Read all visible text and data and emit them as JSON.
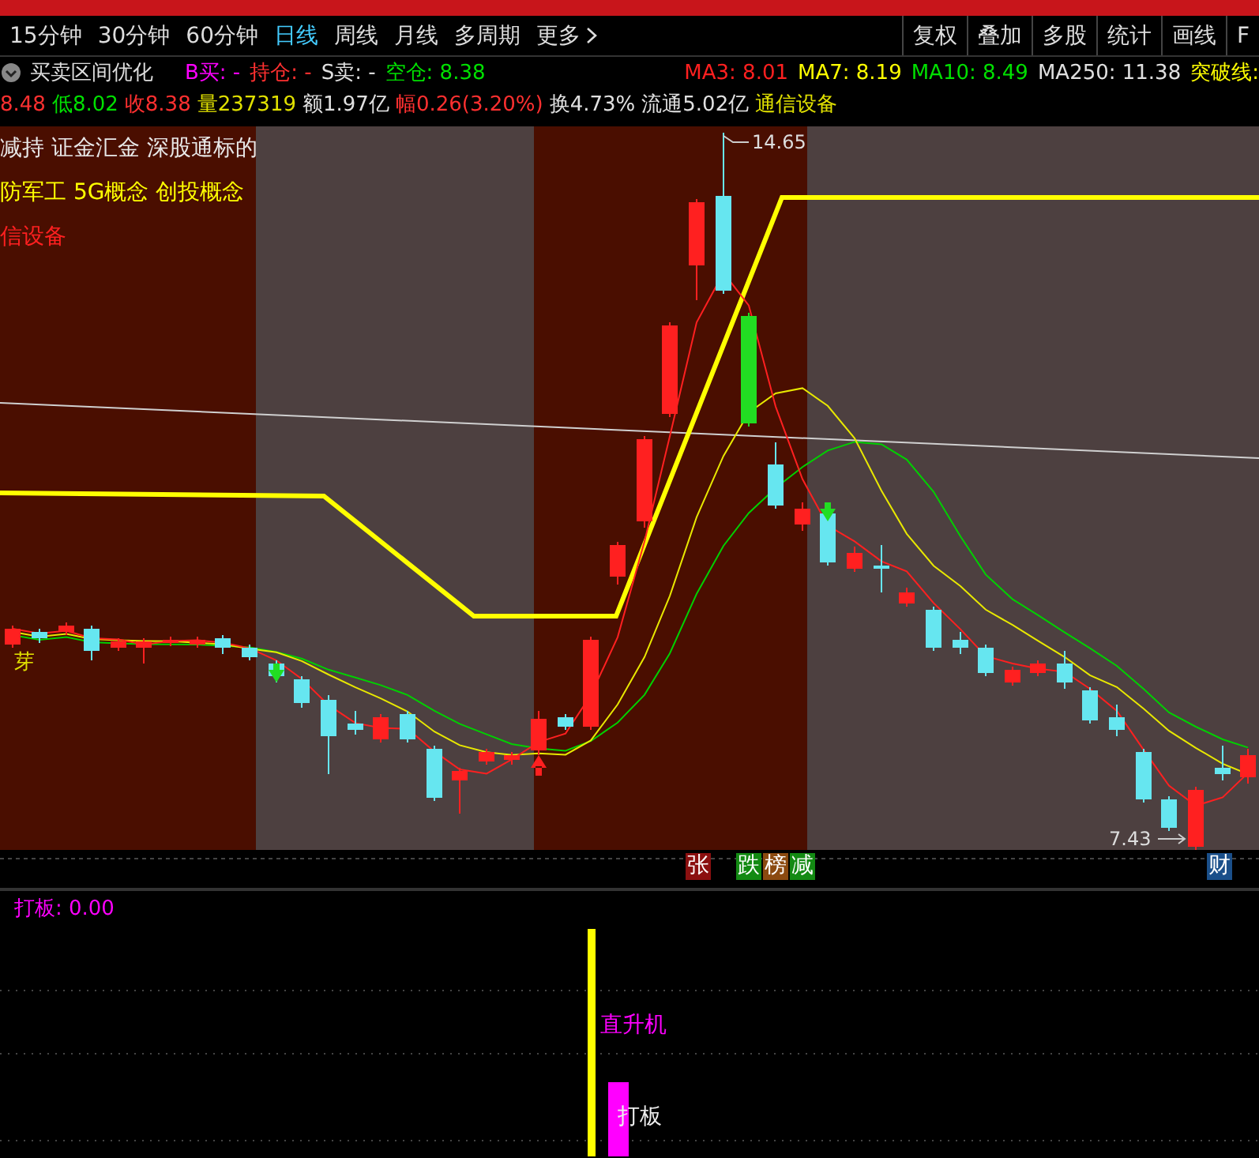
{
  "toolbar": {
    "periods": [
      {
        "label": "15分钟",
        "selected": false
      },
      {
        "label": "30分钟",
        "selected": false
      },
      {
        "label": "60分钟",
        "selected": false
      },
      {
        "label": "日线",
        "selected": true
      },
      {
        "label": "周线",
        "selected": false
      },
      {
        "label": "月线",
        "selected": false
      },
      {
        "label": "多周期",
        "selected": false
      }
    ],
    "more": "更多",
    "tools": [
      "复权",
      "叠加",
      "多股",
      "统计",
      "画线",
      "F"
    ]
  },
  "indicator": {
    "name": "买卖区间优化",
    "values": [
      {
        "text": "B买: -",
        "color": "#ff00ff"
      },
      {
        "text": "持仓: -",
        "color": "#ff3030"
      },
      {
        "text": "S卖: -",
        "color": "#e0e0e0"
      },
      {
        "text": "空仓: 8.38",
        "color": "#00e000"
      }
    ],
    "averages": [
      {
        "text": "MA3: 8.01",
        "color": "#ff2020"
      },
      {
        "text": "MA7: 8.19",
        "color": "#ffff00"
      },
      {
        "text": "MA10: 8.49",
        "color": "#00e000"
      },
      {
        "text": "MA250: 11.38",
        "color": "#e0e0e0"
      },
      {
        "text": "突破线:",
        "color": "#ffff00"
      }
    ]
  },
  "quote": [
    {
      "text": "8.48",
      "color": "#ff3030"
    },
    {
      "text": "低8.02",
      "color": "#00e000"
    },
    {
      "text": "收8.38",
      "color": "#ff3030"
    },
    {
      "text": "量237319",
      "color": "#e0e000"
    },
    {
      "text": "额1.97亿",
      "color": "#e0e0e0"
    },
    {
      "text": "幅0.26(3.20%)",
      "color": "#ff3030"
    },
    {
      "text": "换4.73%",
      "color": "#e0e0e0"
    },
    {
      "text": "流通5.02亿",
      "color": "#e0e0e0"
    },
    {
      "text": "通信设备",
      "color": "#e0e000"
    }
  ],
  "chart": {
    "concepts": [
      {
        "text": "减持 证金汇金 深股通标的",
        "color": "#e8e8e8"
      },
      {
        "text": "防军工 5G概念 创投概念",
        "color": "#ffff00"
      },
      {
        "text": "信设备",
        "color": "#ff2020"
      }
    ],
    "high_label": "14.65",
    "low_label": "7.43",
    "signal": "芽"
  },
  "markers": [
    {
      "text": "张",
      "color": "#8b1010"
    },
    {
      "text": "跌",
      "color": "#138a13"
    },
    {
      "text": "榜",
      "color": "#8b4a10"
    },
    {
      "text": "减",
      "color": "#138a13"
    },
    {
      "text": "财",
      "color": "#1a4f8a"
    }
  ],
  "sub_chart": {
    "title": "打板: 0.00",
    "labels": [
      "直升机",
      "打板"
    ]
  }
}
